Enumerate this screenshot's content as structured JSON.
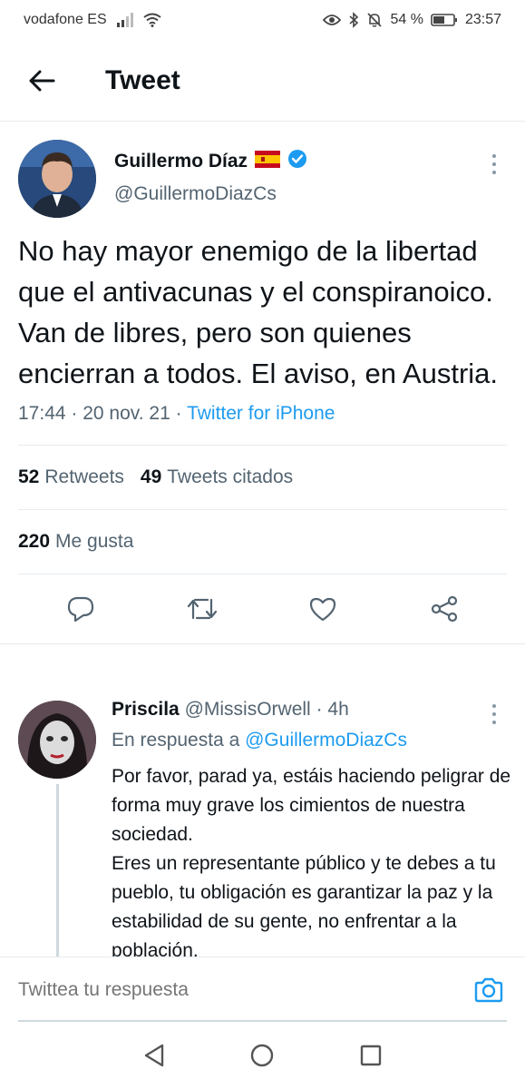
{
  "status_bar": {
    "carrier": "vodafone ES",
    "battery": "54 %",
    "time": "23:57",
    "icons": [
      "signal-icon",
      "wifi-icon",
      "eye-icon",
      "bluetooth-icon",
      "mute-icon",
      "battery-icon"
    ]
  },
  "header": {
    "title": "Tweet"
  },
  "tweet": {
    "display_name": "Guillermo Díaz",
    "flag": "spain-flag-icon",
    "verified": true,
    "handle": "@GuillermoDiazCs",
    "text": "No hay mayor enemigo de la libertad que el antivacunas y el conspiranoico. Van de libres, pero son quienes encierran a todos. El aviso, en Austria.",
    "time": "17:44",
    "date": "20 nov. 21",
    "source": "Twitter for iPhone",
    "retweets_count": "52",
    "retweets_label": "Retweets",
    "quotes_count": "49",
    "quotes_label": "Tweets citados",
    "likes_count": "220",
    "likes_label": "Me gusta"
  },
  "reply": {
    "display_name": "Priscila",
    "handle": "@MissisOrwell",
    "age": "4h",
    "in_reply_prefix": "En respuesta a",
    "in_reply_handle": "@GuillermoDiazCs",
    "text_line1": "Por favor, parad ya, estáis haciendo peligrar de forma muy grave los cimientos de nuestra sociedad.",
    "text_line2": "Eres un representante público y te debes a tu pueblo, tu obligación es garantizar la paz y la estabilidad de su gente, no enfrentar a la población."
  },
  "compose": {
    "placeholder": "Twittea tu respuesta"
  },
  "colors": {
    "accent": "#1d9bf0",
    "text": "#0f1419",
    "secondary": "#536471",
    "divider": "#e6ecf0"
  }
}
